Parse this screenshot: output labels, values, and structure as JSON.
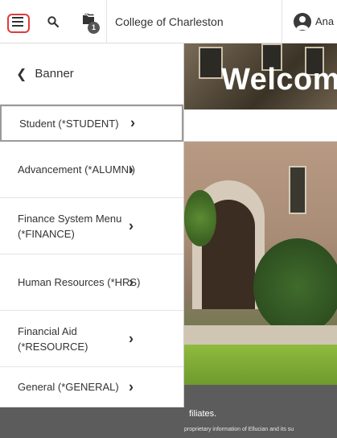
{
  "topbar": {
    "menu_icon": "hamburger-menu-icon",
    "search_icon": "search-icon",
    "recent_icon": "folder-icon",
    "recent_badge": "1",
    "college_name": "College of Charleston",
    "user_name": "Ana"
  },
  "menu": {
    "back_label": "Banner",
    "items": [
      {
        "label": "Student (*STUDENT)"
      },
      {
        "label": "Advancement (*ALUMNI)"
      },
      {
        "label": "Finance System Menu (*FINANCE)"
      },
      {
        "label": "Human Resources (*HRS)"
      },
      {
        "label": "Financial Aid (*RESOURCE)"
      },
      {
        "label": "General (*GENERAL)"
      }
    ]
  },
  "page": {
    "welcome": "Welcome",
    "footer_line1": "filiates.",
    "footer_line2": "proprietary information of Ellucian and its su"
  },
  "colors": {
    "highlight": "#e03a3a",
    "footer": "#5c5c5c"
  }
}
